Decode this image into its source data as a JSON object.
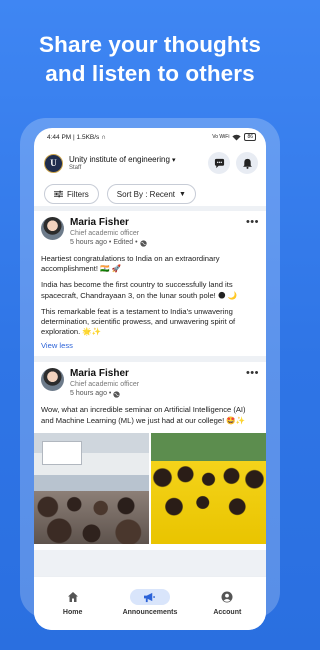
{
  "headline": {
    "line1": "Share your thoughts",
    "line2": "and listen to others"
  },
  "status_bar": {
    "time": "4:44 PM",
    "speed": "1.5KB/s",
    "network": "Vo WiFi",
    "battery": "86"
  },
  "app_bar": {
    "org_name": "Unity institute of engineering",
    "role": "Staff",
    "icons": [
      "chat-icon",
      "bell-icon"
    ]
  },
  "filters": {
    "filters_label": "Filters",
    "sort_label": "Sort By : Recent"
  },
  "posts": [
    {
      "author": "Maria Fisher",
      "title": "Chief academic officer",
      "meta": "5 hours ago • Edited •",
      "paragraphs": [
        "Heartiest congratulations to India on an extraordinary accomplishment! 🇮🇳 🚀",
        "India has become the first country to successfully land its spacecraft, Chandrayaan 3, on the lunar south pole! 🌑 🌙",
        "This remarkable feat is a testament to India's unwavering determination, scientific prowess, and unwavering spirit of exploration. 🌟✨"
      ],
      "view_less": "View less"
    },
    {
      "author": "Maria Fisher",
      "title": "Chief academic officer",
      "meta": "5 hours ago •",
      "paragraphs": [
        "Wow, what an incredible seminar on Artificial Intelligence (AI) and Machine Learning (ML) we just had at our college! 🤩✨"
      ]
    }
  ],
  "bottom_nav": {
    "items": [
      {
        "label": "Home",
        "icon": "home-icon"
      },
      {
        "label": "Announcements",
        "icon": "megaphone-icon",
        "active": true
      },
      {
        "label": "Account",
        "icon": "account-icon"
      }
    ]
  },
  "colors": {
    "background": "#3a80ee",
    "accent": "#2c63d8",
    "active_nav": "#d9e5fb"
  }
}
